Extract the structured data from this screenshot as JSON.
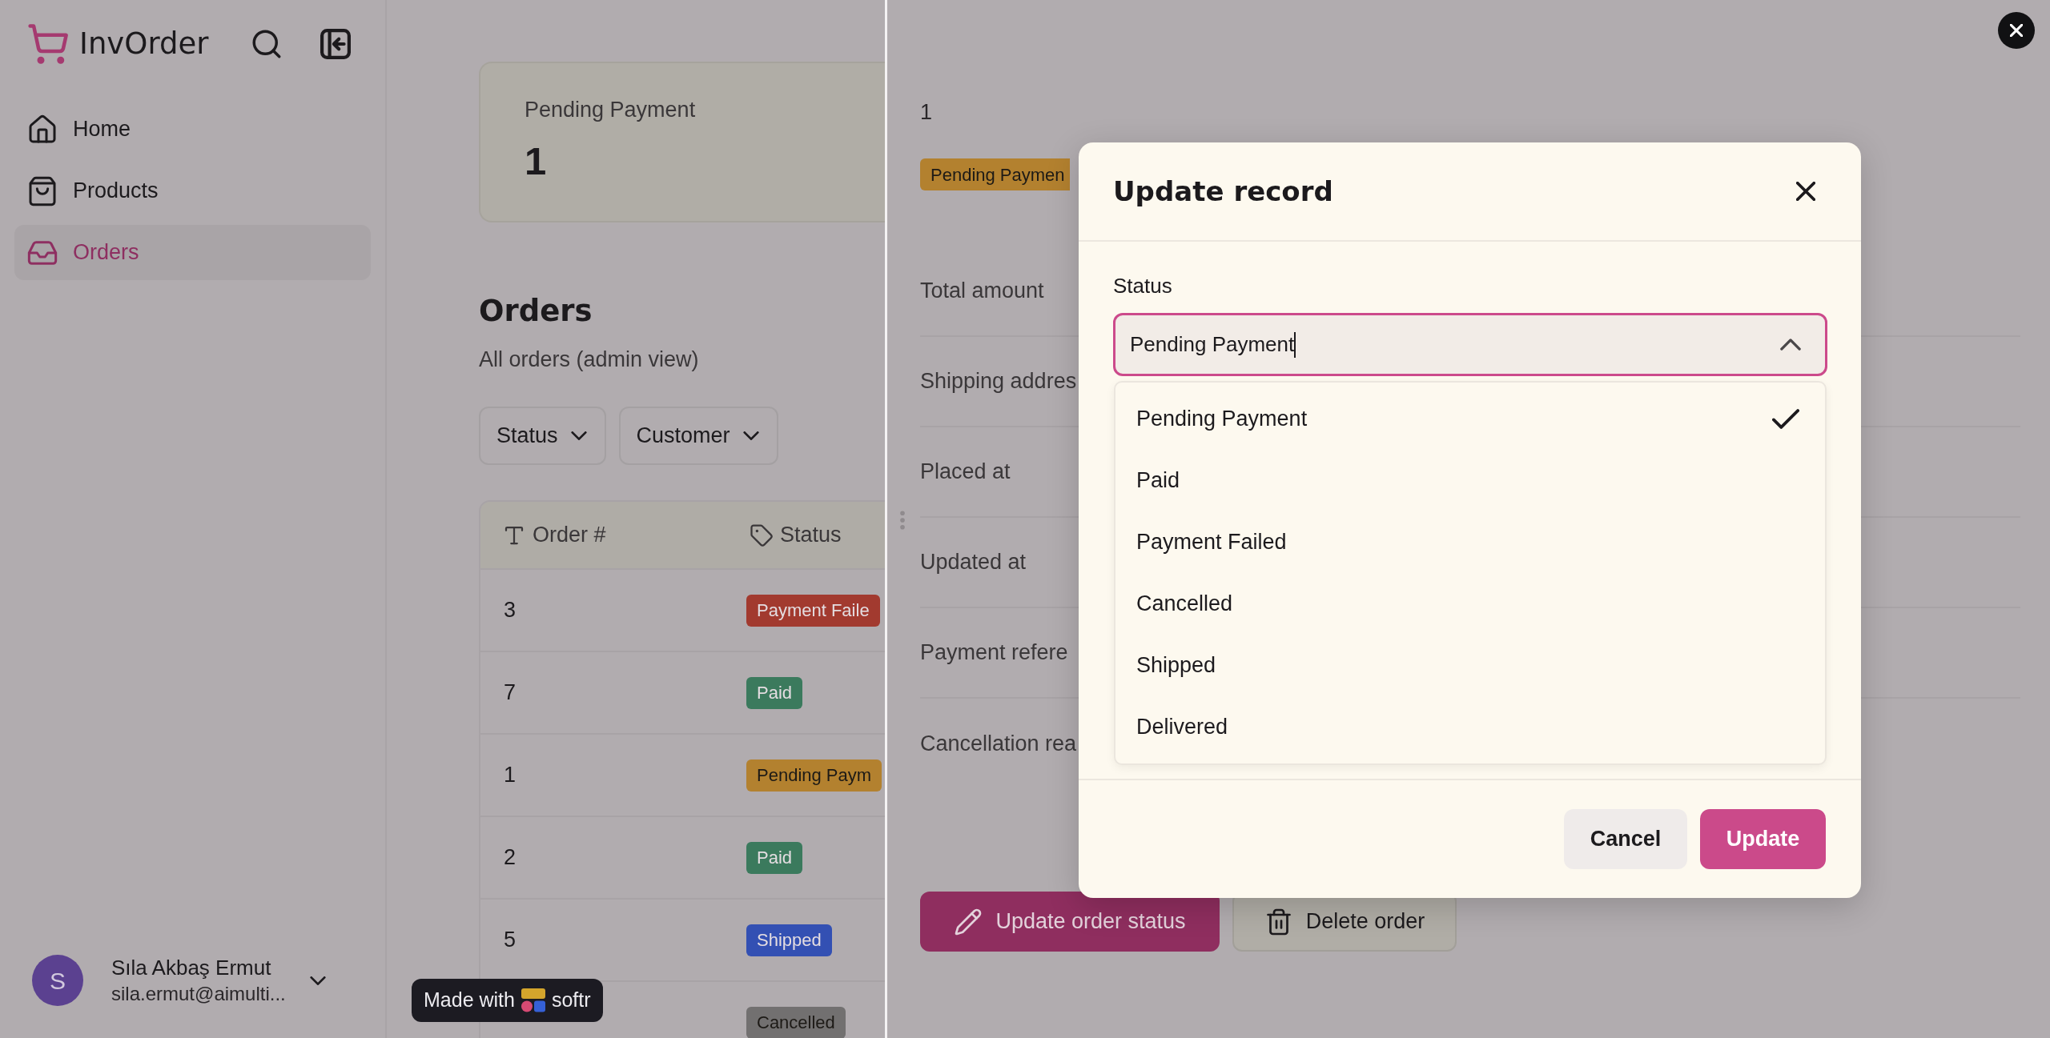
{
  "sidebar": {
    "app_name": "InvOrder",
    "nav": [
      {
        "label": "Home",
        "selected": false
      },
      {
        "label": "Products",
        "selected": false
      },
      {
        "label": "Orders",
        "selected": true
      }
    ],
    "user": {
      "initial": "S",
      "name": "Sıla Akbaş Ermut",
      "email": "sila.ermut@aimulti..."
    }
  },
  "stat_card": {
    "label": "Pending Payment",
    "value": "1"
  },
  "orders": {
    "title": "Orders",
    "subtitle": "All orders (admin view)",
    "filters": [
      "Status",
      "Customer"
    ],
    "table": {
      "columns": [
        {
          "label": "Order #",
          "kind": "text"
        },
        {
          "label": "Status",
          "kind": "tag"
        }
      ],
      "rows": [
        {
          "order": "3",
          "status": "Payment Faile",
          "color": "#a23a2f"
        },
        {
          "order": "7",
          "status": "Paid",
          "color": "#3b7a5d"
        },
        {
          "order": "1",
          "status": "Pending Paym",
          "color": "#b3812f"
        },
        {
          "order": "2",
          "status": "Paid",
          "color": "#3b7a5d"
        },
        {
          "order": "5",
          "status": "Shipped",
          "color": "#3350b3"
        },
        {
          "status": "Cancelled",
          "color": "#727070"
        }
      ]
    }
  },
  "made_with_badge": {
    "prefix": "Made with",
    "brand": "softr"
  },
  "record_panel": {
    "order": "1",
    "status": "Pending Paymen",
    "fields": [
      "Total amount",
      "Shipping addres",
      "Placed at",
      "Updated at",
      "Payment refere",
      "Cancellation rea"
    ],
    "actions": [
      {
        "label": "Update order status",
        "kind": "primary"
      },
      {
        "label": "Delete order",
        "kind": "danger"
      }
    ]
  },
  "dialog": {
    "title": "Update record",
    "field": {
      "label": "Status",
      "value": "Pending Payment",
      "expanded": true
    },
    "options": [
      {
        "label": "Pending Payment",
        "selected": true
      },
      {
        "label": "Paid",
        "selected": false
      },
      {
        "label": "Payment Failed",
        "selected": false
      },
      {
        "label": "Cancelled",
        "selected": false
      },
      {
        "label": "Shipped",
        "selected": false
      },
      {
        "label": "Delivered",
        "selected": false
      }
    ],
    "buttons": [
      {
        "label": "Cancel",
        "kind": "secondary"
      },
      {
        "label": "Update",
        "kind": "primary"
      }
    ]
  }
}
